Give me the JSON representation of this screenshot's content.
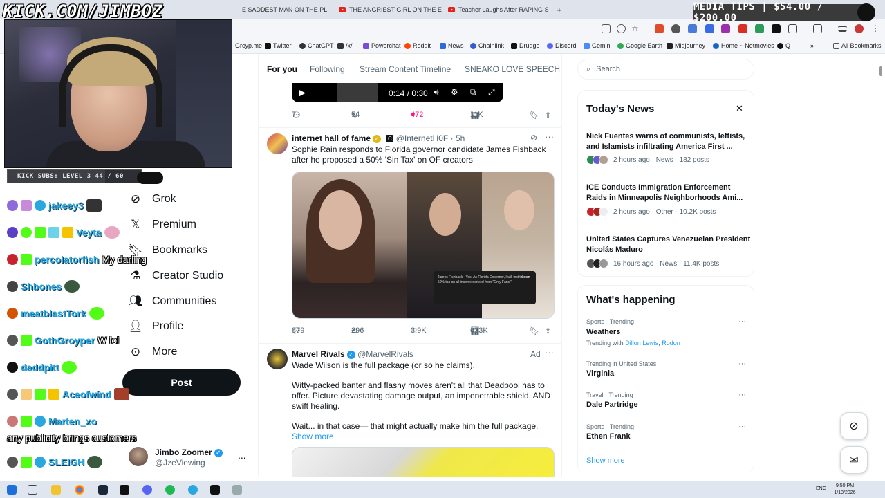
{
  "overlay": {
    "kick_url": "KICK.COM/JIMBOZ",
    "subs_label": "KICK SUBS: LEVEL 3  44 / 60",
    "subs_progress": 0.733,
    "media_tips": "MEDIA TIPS | $54.00 / $200.00"
  },
  "browser": {
    "tabs": [
      {
        "label": "E SADDEST MAN ON THE PL"
      },
      {
        "label": "THE ANGRIEST GIRL ON THE EI"
      },
      {
        "label": "Teacher Laughs After RAPING S"
      }
    ],
    "new_tab": "+",
    "bookmarks": [
      "Grcyp.me",
      "Twitter",
      "ChatGPT",
      "/x/",
      "Powerchat",
      "Reddit",
      "News",
      "Chainlink",
      "Drudge",
      "Discord",
      "Gemini",
      "Google Earth",
      "Midjourney",
      "Home ~ Netmovies",
      "Q"
    ],
    "all_bookmarks": "All Bookmarks"
  },
  "chat": [
    {
      "name": "jakeey3",
      "msg": ""
    },
    {
      "name": "Veyta",
      "msg": ""
    },
    {
      "name": "percolatorfish",
      "msg": "My darling"
    },
    {
      "name": "Shbones",
      "msg": ""
    },
    {
      "name": "meatblastTork",
      "msg": ""
    },
    {
      "name": "GothGroyper",
      "msg": "W lol"
    },
    {
      "name": "daddpitt",
      "msg": ""
    },
    {
      "name": "Aceofwind",
      "msg": ""
    },
    {
      "name": "Marten_xo",
      "msg": ""
    },
    {
      "name": "",
      "msg": "any publicity brings customers"
    },
    {
      "name": "SLEIGH",
      "msg": ""
    }
  ],
  "nav": {
    "partial_label": "at",
    "items": [
      "Grok",
      "Premium",
      "Bookmarks",
      "Creator Studio",
      "Communities",
      "Profile",
      "More"
    ],
    "post_label": "Post",
    "account_name": "Jimbo Zoomer",
    "account_handle": "@JzeViewing",
    "account_more": "..."
  },
  "timeline": {
    "tabs": [
      "For you",
      "Following",
      "Stream Content Timeline",
      "SNEAKO LOVE SPEECH"
    ],
    "video_time": "0:14 / 0:30",
    "video_actions": {
      "replies": "7",
      "reposts": "54",
      "likes": "472",
      "views": "11K"
    },
    "tweet1": {
      "name": "internet hall of fame",
      "badge": "C",
      "handle": "@InternetH0F",
      "time": "· 5h",
      "text": "Sophie Rain responds to Florida governor candidate James Fishback after he proposed a 50% 'Sin Tax' on OF creators",
      "card_text": "James Fishback · Yes, As Florida Governor, I will institute an 50% tax on all income derived from \"Only Fans.\"",
      "card_source": "X.com",
      "replies": "879",
      "reposts": "296",
      "likes": "3.9K",
      "views": "673K"
    },
    "tweet2": {
      "name": "Marvel Rivals",
      "handle": "@MarvelRivals",
      "ad_label": "Ad",
      "line1": "Wade Wilson is the full package (or so he claims).",
      "line2": "Witty-packed banter and flashy moves aren't all that Deadpool has to offer. Picture devastating damage output, an impenetrable shield, AND swift healing.",
      "line3": "Wait... in that case— that might actually make him the full package.",
      "show_more": "Show more"
    }
  },
  "sidebar": {
    "search_placeholder": "Search",
    "news_title": "Today's News",
    "news": [
      {
        "title": "Nick Fuentes warns of communists, leftists, and Islamists infiltrating America First ...",
        "meta": "2 hours ago · News · 182 posts"
      },
      {
        "title": "ICE Conducts Immigration Enforcement Raids in Minneapolis Neighborhoods Ami...",
        "meta": "2 hours ago · Other · 10.2K posts"
      },
      {
        "title": "United States Captures Venezuelan President Nicolás Maduro",
        "meta": "16 hours ago · News · 11.4K posts"
      }
    ],
    "happening_title": "What's happening",
    "trends": [
      {
        "meta": "Sports · Trending",
        "name": "Weathers",
        "sub_prefix": "Trending with",
        "sub_a": "Dillon Lewis",
        "sub_b": "Rodon"
      },
      {
        "meta": "Trending in United States",
        "name": "Virginia"
      },
      {
        "meta": "Travel · Trending",
        "name": "Dale Partridge"
      },
      {
        "meta": "Sports · Trending",
        "name": "Ethen Frank"
      }
    ],
    "show_more": "Show more"
  },
  "taskbar": {
    "lang": "ENG",
    "time": "9:50 PM",
    "date": "1/13/2026"
  },
  "colors": {
    "x_blue": "#1d9bf0",
    "like_pink": "#f91880",
    "text_primary": "#0f1419",
    "text_secondary": "#536471"
  }
}
